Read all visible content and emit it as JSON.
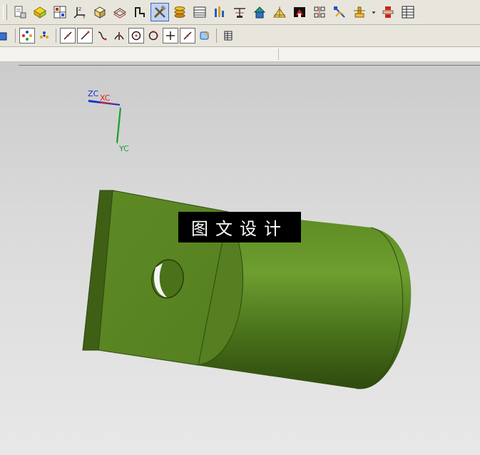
{
  "toolbar_main": {
    "icons": [
      "document-properties-icon",
      "open-part-icon",
      "grid-layout-icon",
      "csys-icon",
      "box-view-icon",
      "wireframe-icon",
      "sketch-icon",
      "tools-icon",
      "layers-icon",
      "table-icon",
      "bar-chart-icon",
      "dimension-icon",
      "house-icon",
      "drafting-icon",
      "flag-icon",
      "align-icon",
      "analysis-icon",
      "assembly-icon",
      "dropdown-arrow-icon",
      "sync-icon",
      "spreadsheet-icon"
    ],
    "active_icon": "tools-icon"
  },
  "snap_toolbar": {
    "icons": [
      "cube-icon",
      "snap-points-icon",
      "snap-grid-icon",
      "line-icon",
      "line-boxed-icon",
      "curve-icon",
      "intersection-icon",
      "circle-center-icon",
      "circle-icon",
      "plus-icon",
      "tangent-icon",
      "view-icon",
      "spreadsheet-small-icon"
    ]
  },
  "viewport": {
    "csys": {
      "z_label": "ZC",
      "x_label": "XC",
      "y_label": "YC"
    },
    "watermark": "图文设计",
    "colors": {
      "part_face": "#5e8a25",
      "part_dark": "#3f5f15",
      "part_light": "#6e9e30",
      "z_axis": "#1030d0",
      "x_axis": "#e02020",
      "y_axis": "#18a030"
    }
  }
}
